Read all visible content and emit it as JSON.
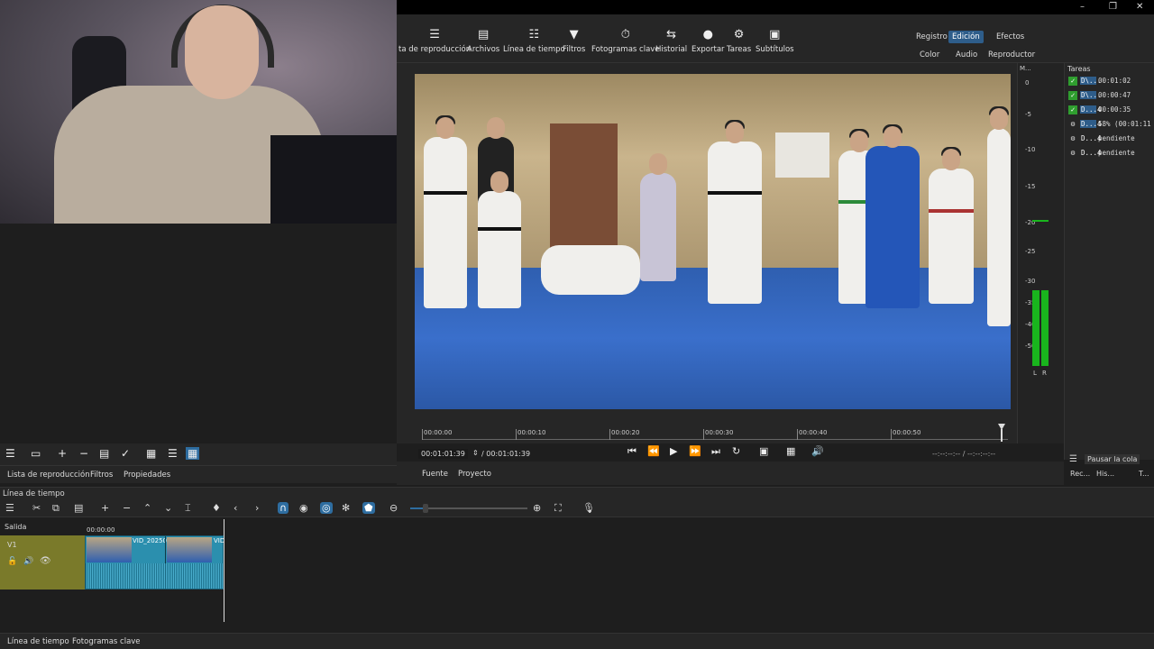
{
  "toolbar": {
    "items": [
      {
        "label": "ta de reproducción",
        "icon": "list-icon"
      },
      {
        "label": "Archivos",
        "icon": "files-icon"
      },
      {
        "label": "Línea de tiempo",
        "icon": "timeline-icon"
      },
      {
        "label": "Filtros",
        "icon": "filter-icon"
      },
      {
        "label": "Fotogramas clave",
        "icon": "stopwatch-icon"
      },
      {
        "label": "Historial",
        "icon": "history-icon"
      },
      {
        "label": "Exportar",
        "icon": "export-icon"
      },
      {
        "label": "Tareas",
        "icon": "gear-icon"
      },
      {
        "label": "Subtítulos",
        "icon": "subtitles-icon"
      }
    ],
    "layouts": {
      "registro": "Registro",
      "edicion": "Edición",
      "efectos": "Efectos",
      "color": "Color",
      "audio": "Audio",
      "reproductor": "Reproductor"
    }
  },
  "player": {
    "ruler": [
      "00:00:00",
      "00:00:10",
      "00:00:20",
      "00:00:30",
      "00:00:40",
      "00:00:50"
    ],
    "position": "00:01:01:39",
    "duration": "/ 00:01:01:39",
    "inout": "--:--:--:-- / --:--:--:--",
    "tabs": {
      "source": "Fuente",
      "project": "Proyecto"
    }
  },
  "meter": {
    "title": "M...",
    "levels": [
      "0",
      "-5",
      "-10",
      "-15",
      "-20",
      "-25",
      "-30",
      "-35",
      "-40",
      "-50"
    ],
    "left": "L",
    "right": "R"
  },
  "tasks": {
    "title": "Tareas",
    "items": [
      {
        "name": "D\\...",
        "status": "00:01:02"
      },
      {
        "name": "D\\...",
        "status": "00:00:47"
      },
      {
        "name": "D...4",
        "status": "00:00:35"
      },
      {
        "name": "D...4",
        "status": "58% (00:01:11"
      },
      {
        "name": "D...4",
        "status": "pendiente"
      },
      {
        "name": "D...4",
        "status": "pendiente"
      }
    ],
    "pause_queue": "Pausar la cola",
    "tabs": {
      "rec": "Rec...",
      "his": "His...",
      "t": "T..."
    }
  },
  "playlist": {
    "tabs": {
      "playlist": "Lista de reproducción",
      "filters": "Filtros",
      "properties": "Propiedades"
    }
  },
  "timeline": {
    "title": "Línea de tiempo",
    "output_label": "Salida",
    "track_label": "V1",
    "time_start": "00:00:00",
    "clip_label": "VID_20250",
    "clip_label_2": "VID"
  },
  "bottom_tabs": {
    "timeline": "Línea de tiempo",
    "keyframes": "Fotogramas clave"
  },
  "colors": {
    "accent": "#2e5d8a",
    "meter_green": "#19b51d",
    "track_head": "#7a7a2a",
    "clip": "#2b8fae"
  }
}
